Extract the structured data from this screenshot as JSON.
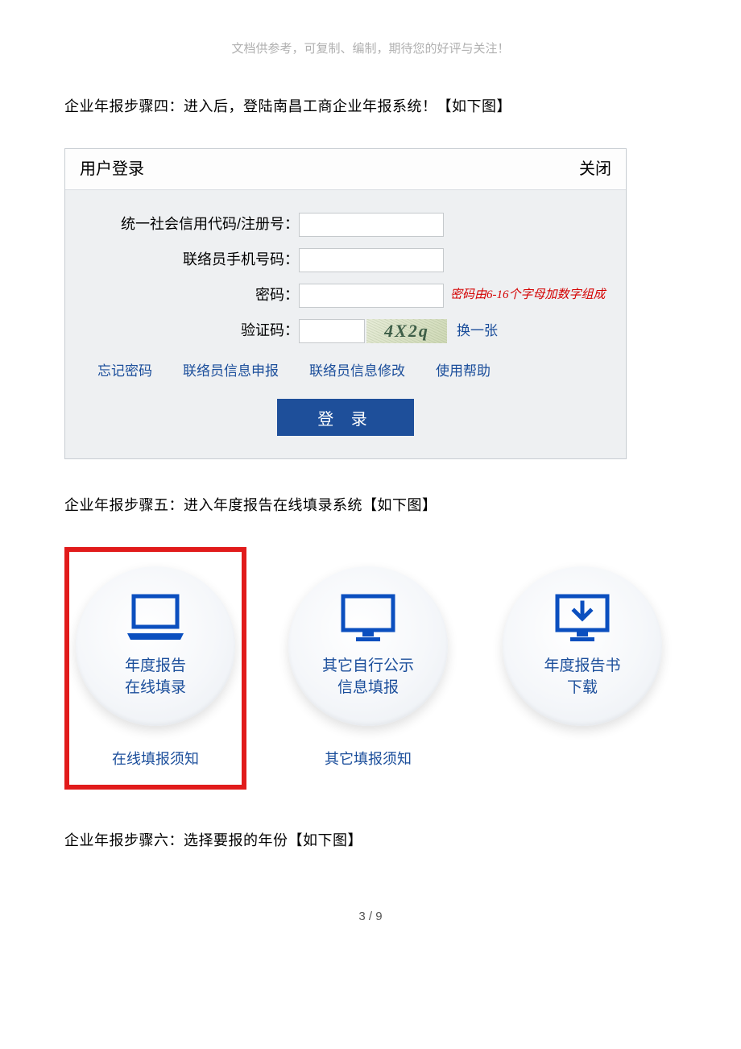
{
  "top_note": "文档供参考，可复制、编制，期待您的好评与关注！",
  "step4_title": "企业年报步骤四：进入后，登陆南昌工商企业年报系统！【如下图】",
  "step5_title": "企业年报步骤五：进入年度报告在线填录系统【如下图】",
  "step6_title": "企业年报步骤六：选择要报的年份【如下图】",
  "login": {
    "header_title": "用户登录",
    "close_label": "关闭",
    "labels": {
      "uscc": "统一社会信用代码/注册号：",
      "phone": "联络员手机号码：",
      "password": "密码：",
      "captcha": "验证码："
    },
    "password_hint": "密码由6-16个字母加数字组成",
    "captcha_value": "4X2q",
    "refresh_link": "换一张",
    "links": {
      "forgot": "忘记密码",
      "liaison_apply": "联络员信息申报",
      "liaison_edit": "联络员信息修改",
      "help": "使用帮助"
    },
    "login_button": "登 录"
  },
  "cards": {
    "report": {
      "line1": "年度报告",
      "line2": "在线填录",
      "sublink": "在线填报须知"
    },
    "other": {
      "line1": "其它自行公示",
      "line2": "信息填报",
      "sublink": "其它填报须知"
    },
    "download": {
      "line1": "年度报告书",
      "line2": "下载"
    }
  },
  "pager": "3 / 9"
}
